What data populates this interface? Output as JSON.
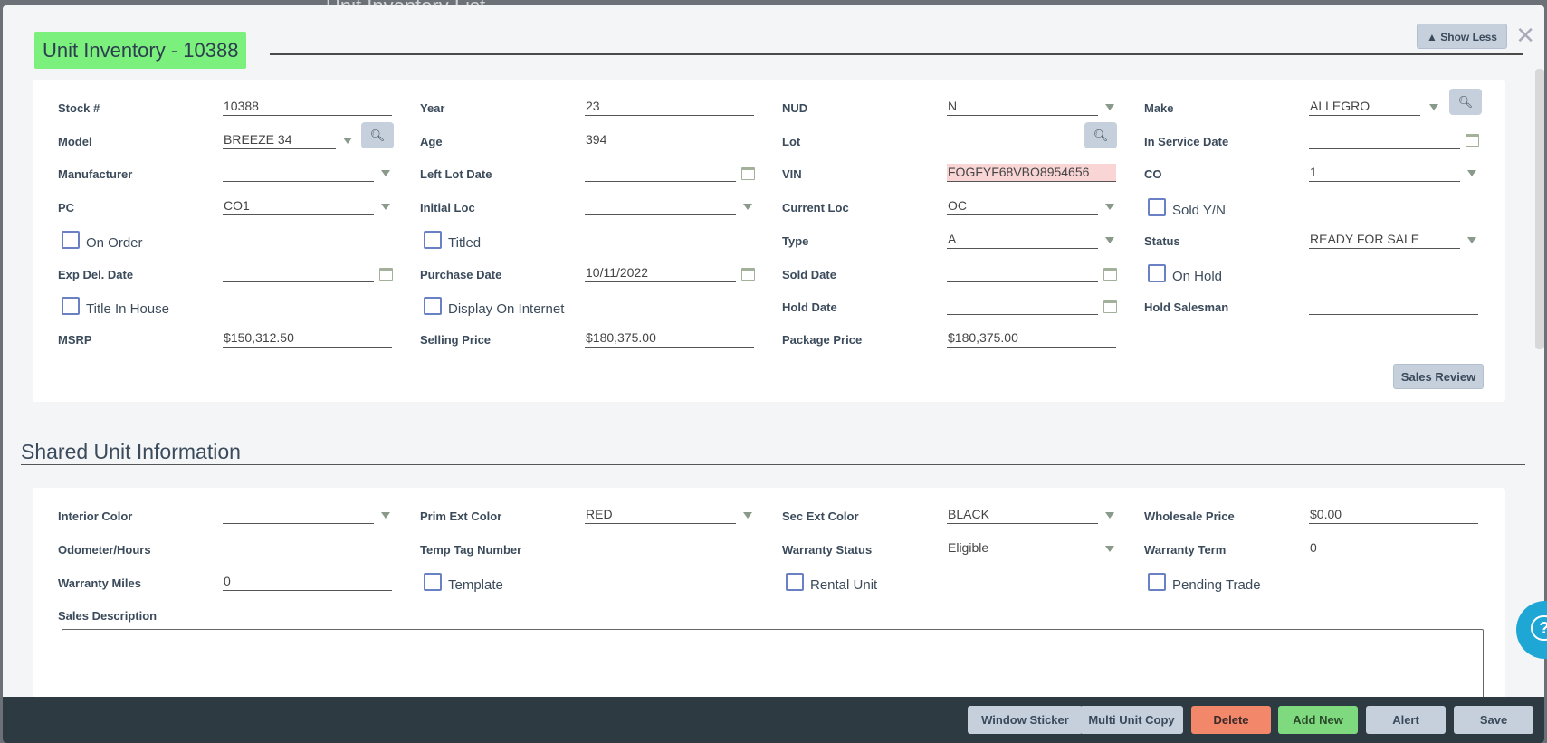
{
  "background": {
    "partial_title": "Unit Inventory List",
    "close_label": "Close"
  },
  "header": {
    "title": "Unit Inventory - 10388",
    "show_less_label": "Show Less",
    "close_icon": "close-icon"
  },
  "unit": {
    "stock_label": "Stock #",
    "stock_value": "10388",
    "year_label": "Year",
    "year_value": "23",
    "nud_label": "NUD",
    "nud_value": "N",
    "make_label": "Make",
    "make_value": "ALLEGRO",
    "model_label": "Model",
    "model_value": "BREEZE 34",
    "age_label": "Age",
    "age_value": "394",
    "lot_label": "Lot",
    "lot_value": "",
    "in_service_label": "In Service Date",
    "in_service_value": "",
    "manufacturer_label": "Manufacturer",
    "manufacturer_value": "",
    "left_lot_label": "Left Lot Date",
    "left_lot_value": "",
    "vin_label": "VIN",
    "vin_value": "FOGFYF68VBO8954656",
    "co_label": "CO",
    "co_value": "1",
    "pc_label": "PC",
    "pc_value": "CO1",
    "initial_loc_label": "Initial Loc",
    "initial_loc_value": "",
    "current_loc_label": "Current Loc",
    "current_loc_value": "OC",
    "sold_yn_label": "Sold Y/N",
    "on_order_label": "On Order",
    "titled_label": "Titled",
    "type_label": "Type",
    "type_value": "A",
    "status_label": "Status",
    "status_value": "READY FOR SALE",
    "exp_del_label": "Exp Del. Date",
    "exp_del_value": "",
    "purchase_date_label": "Purchase Date",
    "purchase_date_value": "10/11/2022",
    "sold_date_label": "Sold Date",
    "sold_date_value": "",
    "on_hold_label": "On Hold",
    "title_in_house_label": "Title In House",
    "display_internet_label": "Display On Internet",
    "hold_date_label": "Hold Date",
    "hold_date_value": "",
    "hold_salesman_label": "Hold Salesman",
    "hold_salesman_value": "",
    "msrp_label": "MSRP",
    "msrp_value": "$150,312.50",
    "selling_price_label": "Selling Price",
    "selling_price_value": "$180,375.00",
    "package_price_label": "Package Price",
    "package_price_value": "$180,375.00",
    "sales_review_label": "Sales Review"
  },
  "shared": {
    "section_title": "Shared Unit Information",
    "interior_color_label": "Interior Color",
    "interior_color_value": "",
    "prim_ext_label": "Prim Ext Color",
    "prim_ext_value": "RED",
    "sec_ext_label": "Sec Ext Color",
    "sec_ext_value": "BLACK",
    "wholesale_label": "Wholesale Price",
    "wholesale_value": "$0.00",
    "odometer_label": "Odometer/Hours",
    "odometer_value": "",
    "temp_tag_label": "Temp Tag Number",
    "temp_tag_value": "",
    "warranty_status_label": "Warranty Status",
    "warranty_status_value": "Eligible",
    "warranty_term_label": "Warranty Term",
    "warranty_term_value": "0",
    "warranty_miles_label": "Warranty Miles",
    "warranty_miles_value": "0",
    "template_label": "Template",
    "rental_label": "Rental Unit",
    "pending_trade_label": "Pending Trade",
    "sales_desc_label": "Sales Description"
  },
  "footer": {
    "window_sticker": "Window Sticker",
    "multi_unit_copy": "Multi Unit Copy",
    "delete": "Delete",
    "add_new": "Add New",
    "alert": "Alert",
    "save": "Save"
  },
  "colors": {
    "title_badge": "#7cf07c",
    "delete": "#f2876a",
    "add_new": "#7fd97f",
    "help": "#1ea7d5",
    "footer": "#2e3a41"
  }
}
